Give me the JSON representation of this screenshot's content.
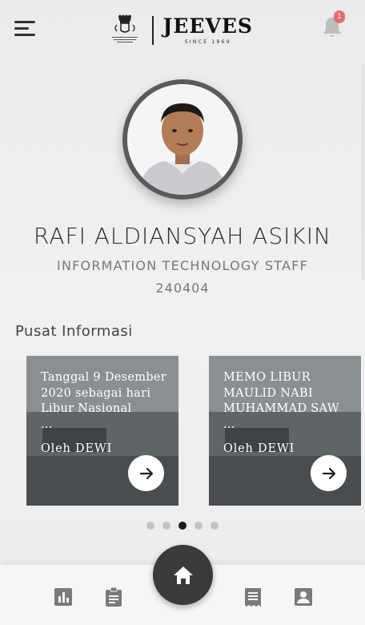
{
  "header": {
    "brand_name": "JEEVES",
    "brand_tagline": "SINCE 1969",
    "notification_count": "1"
  },
  "profile": {
    "name": "RAFI ALDIANSYAH ASIKIN",
    "role": "INFORMATION TECHNOLOGY STAFF",
    "employee_id": "240404"
  },
  "info_section": {
    "title": "Pusat Informasi",
    "cards": [
      {
        "title": "Tanggal 9 Desember 2020 sebagai hari Libur Nasional\n...",
        "author": "Oleh DEWI"
      },
      {
        "title": "MEMO LIBUR MAULID NABI MUHAMMAD SAW\n...",
        "author": "Oleh DEWI"
      }
    ],
    "page_count": 5,
    "active_page": 3
  },
  "bottom_nav": {
    "items": [
      "chart-icon",
      "clipboard-icon",
      "home-icon",
      "receipt-icon",
      "contact-icon"
    ],
    "active": "home-icon"
  },
  "colors": {
    "accent_dark": "#3a3a3a",
    "badge": "#e86a6a"
  }
}
